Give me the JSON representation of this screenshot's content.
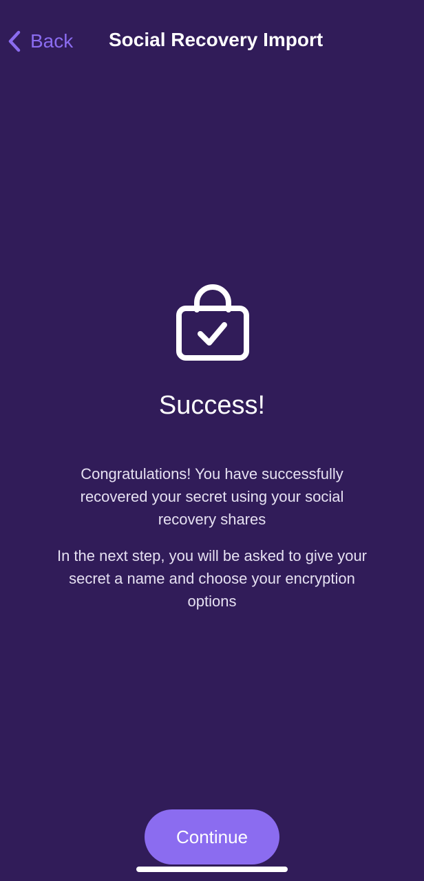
{
  "nav": {
    "back_label": "Back",
    "title": "Social Recovery Import"
  },
  "main": {
    "icon": "lock-check-icon",
    "title": "Success!",
    "message_1": "Congratulations! You have successfully recovered your secret using your social recovery shares",
    "message_2": "In the next step, you will be asked to give your secret a name and choose your encryption options"
  },
  "footer": {
    "continue_label": "Continue"
  },
  "colors": {
    "background": "#311c59",
    "accent": "#8b6cf0",
    "text": "#ffffff"
  }
}
